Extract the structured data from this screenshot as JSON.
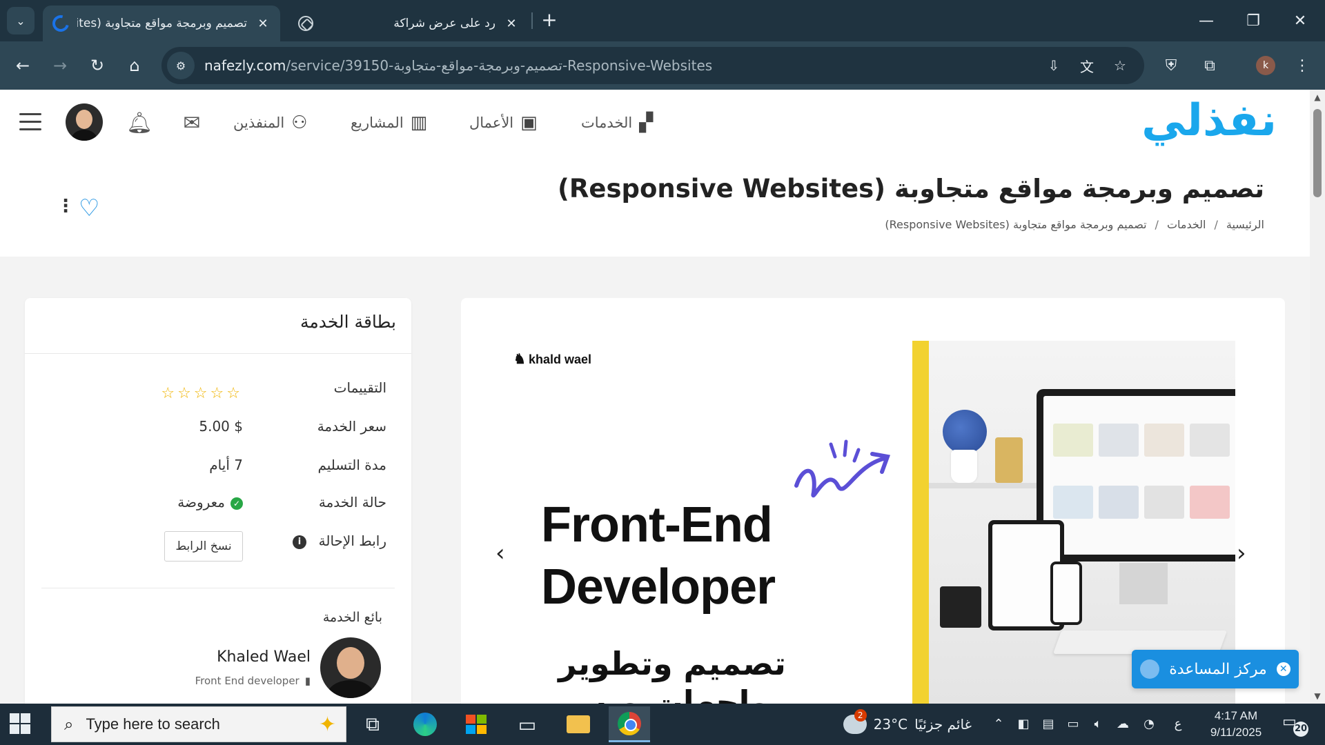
{
  "browser": {
    "tabs": [
      {
        "title": "تصميم وبرمجة مواقع متجاوبة (Responsive Websites)",
        "active": true,
        "favicon": "nafezly-loading-icon"
      },
      {
        "title": "رد على عرض شراكة",
        "active": false,
        "favicon": "openai-icon"
      }
    ],
    "url_domain": "nafezly.com",
    "url_path": "/service/39150-تصميم-وبرمجة-مواقع-متجاوبة-Responsive-Websites",
    "profile_initial": "k",
    "accent_color": "#2e4755"
  },
  "site": {
    "logo": "نفذلي",
    "logo_color": "#1aa7ec",
    "nav": {
      "services": "الخدمات",
      "portfolio": "الأعمال",
      "projects": "المشاريع",
      "freelancers": "المنفذين"
    }
  },
  "page": {
    "title": "تصميم وبرمجة مواقع متجاوبة (Responsive Websites)",
    "breadcrumb": {
      "home": "الرئيسية",
      "services": "الخدمات",
      "current": "تصميم وبرمجة مواقع متجاوبة (Responsive Websites)"
    }
  },
  "service_card": {
    "title": "بطاقة الخدمة",
    "ratings_label": "التقييمات",
    "rating_value": 0,
    "rating_max": 5,
    "price_label": "سعر الخدمة",
    "price": "$ 5.00",
    "delivery_label": "مدة التسليم",
    "delivery": "7 أيام",
    "status_label": "حالة الخدمة",
    "status": "معروضة",
    "status_color": "#28a745",
    "referral_label": "رابط الإحالة",
    "copy_link": "نسخ الرابط",
    "seller_label": "بائع الخدمة",
    "seller_name": "Khaled Wael",
    "seller_role": "Front End developer"
  },
  "gallery": {
    "brand": "khald wael",
    "headline_line1": "Front-End",
    "headline_line2": "Developer",
    "arabic_line1": "تصميم وتطوير",
    "arabic_line2": "واجهات ويب تفاعلية",
    "accent": "#f2d230"
  },
  "help": {
    "label": "مركز المساعدة"
  },
  "taskbar": {
    "search_placeholder": "Type here to search",
    "weather_text": "غائم جزئيًا",
    "temperature": "23°C",
    "weather_badge": "2",
    "lang": "ع",
    "time": "4:17 AM",
    "date": "9/11/2025",
    "notifications": "20"
  }
}
